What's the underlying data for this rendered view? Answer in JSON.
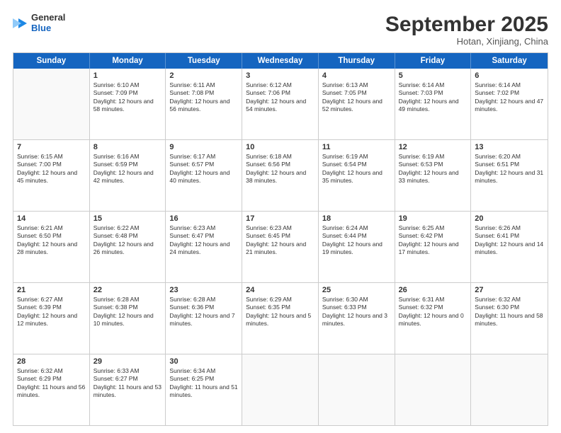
{
  "logo": {
    "line1": "General",
    "line2": "Blue"
  },
  "title": "September 2025",
  "subtitle": "Hotan, Xinjiang, China",
  "header_days": [
    "Sunday",
    "Monday",
    "Tuesday",
    "Wednesday",
    "Thursday",
    "Friday",
    "Saturday"
  ],
  "weeks": [
    [
      {
        "day": "",
        "empty": true
      },
      {
        "day": "1",
        "sunrise": "6:10 AM",
        "sunset": "7:09 PM",
        "daylight": "12 hours and 58 minutes."
      },
      {
        "day": "2",
        "sunrise": "6:11 AM",
        "sunset": "7:08 PM",
        "daylight": "12 hours and 56 minutes."
      },
      {
        "day": "3",
        "sunrise": "6:12 AM",
        "sunset": "7:06 PM",
        "daylight": "12 hours and 54 minutes."
      },
      {
        "day": "4",
        "sunrise": "6:13 AM",
        "sunset": "7:05 PM",
        "daylight": "12 hours and 52 minutes."
      },
      {
        "day": "5",
        "sunrise": "6:14 AM",
        "sunset": "7:03 PM",
        "daylight": "12 hours and 49 minutes."
      },
      {
        "day": "6",
        "sunrise": "6:14 AM",
        "sunset": "7:02 PM",
        "daylight": "12 hours and 47 minutes."
      }
    ],
    [
      {
        "day": "7",
        "sunrise": "6:15 AM",
        "sunset": "7:00 PM",
        "daylight": "12 hours and 45 minutes."
      },
      {
        "day": "8",
        "sunrise": "6:16 AM",
        "sunset": "6:59 PM",
        "daylight": "12 hours and 42 minutes."
      },
      {
        "day": "9",
        "sunrise": "6:17 AM",
        "sunset": "6:57 PM",
        "daylight": "12 hours and 40 minutes."
      },
      {
        "day": "10",
        "sunrise": "6:18 AM",
        "sunset": "6:56 PM",
        "daylight": "12 hours and 38 minutes."
      },
      {
        "day": "11",
        "sunrise": "6:19 AM",
        "sunset": "6:54 PM",
        "daylight": "12 hours and 35 minutes."
      },
      {
        "day": "12",
        "sunrise": "6:19 AM",
        "sunset": "6:53 PM",
        "daylight": "12 hours and 33 minutes."
      },
      {
        "day": "13",
        "sunrise": "6:20 AM",
        "sunset": "6:51 PM",
        "daylight": "12 hours and 31 minutes."
      }
    ],
    [
      {
        "day": "14",
        "sunrise": "6:21 AM",
        "sunset": "6:50 PM",
        "daylight": "12 hours and 28 minutes."
      },
      {
        "day": "15",
        "sunrise": "6:22 AM",
        "sunset": "6:48 PM",
        "daylight": "12 hours and 26 minutes."
      },
      {
        "day": "16",
        "sunrise": "6:23 AM",
        "sunset": "6:47 PM",
        "daylight": "12 hours and 24 minutes."
      },
      {
        "day": "17",
        "sunrise": "6:23 AM",
        "sunset": "6:45 PM",
        "daylight": "12 hours and 21 minutes."
      },
      {
        "day": "18",
        "sunrise": "6:24 AM",
        "sunset": "6:44 PM",
        "daylight": "12 hours and 19 minutes."
      },
      {
        "day": "19",
        "sunrise": "6:25 AM",
        "sunset": "6:42 PM",
        "daylight": "12 hours and 17 minutes."
      },
      {
        "day": "20",
        "sunrise": "6:26 AM",
        "sunset": "6:41 PM",
        "daylight": "12 hours and 14 minutes."
      }
    ],
    [
      {
        "day": "21",
        "sunrise": "6:27 AM",
        "sunset": "6:39 PM",
        "daylight": "12 hours and 12 minutes."
      },
      {
        "day": "22",
        "sunrise": "6:28 AM",
        "sunset": "6:38 PM",
        "daylight": "12 hours and 10 minutes."
      },
      {
        "day": "23",
        "sunrise": "6:28 AM",
        "sunset": "6:36 PM",
        "daylight": "12 hours and 7 minutes."
      },
      {
        "day": "24",
        "sunrise": "6:29 AM",
        "sunset": "6:35 PM",
        "daylight": "12 hours and 5 minutes."
      },
      {
        "day": "25",
        "sunrise": "6:30 AM",
        "sunset": "6:33 PM",
        "daylight": "12 hours and 3 minutes."
      },
      {
        "day": "26",
        "sunrise": "6:31 AM",
        "sunset": "6:32 PM",
        "daylight": "12 hours and 0 minutes."
      },
      {
        "day": "27",
        "sunrise": "6:32 AM",
        "sunset": "6:30 PM",
        "daylight": "11 hours and 58 minutes."
      }
    ],
    [
      {
        "day": "28",
        "sunrise": "6:32 AM",
        "sunset": "6:29 PM",
        "daylight": "11 hours and 56 minutes."
      },
      {
        "day": "29",
        "sunrise": "6:33 AM",
        "sunset": "6:27 PM",
        "daylight": "11 hours and 53 minutes."
      },
      {
        "day": "30",
        "sunrise": "6:34 AM",
        "sunset": "6:25 PM",
        "daylight": "11 hours and 51 minutes."
      },
      {
        "day": "",
        "empty": true
      },
      {
        "day": "",
        "empty": true
      },
      {
        "day": "",
        "empty": true
      },
      {
        "day": "",
        "empty": true
      }
    ]
  ]
}
